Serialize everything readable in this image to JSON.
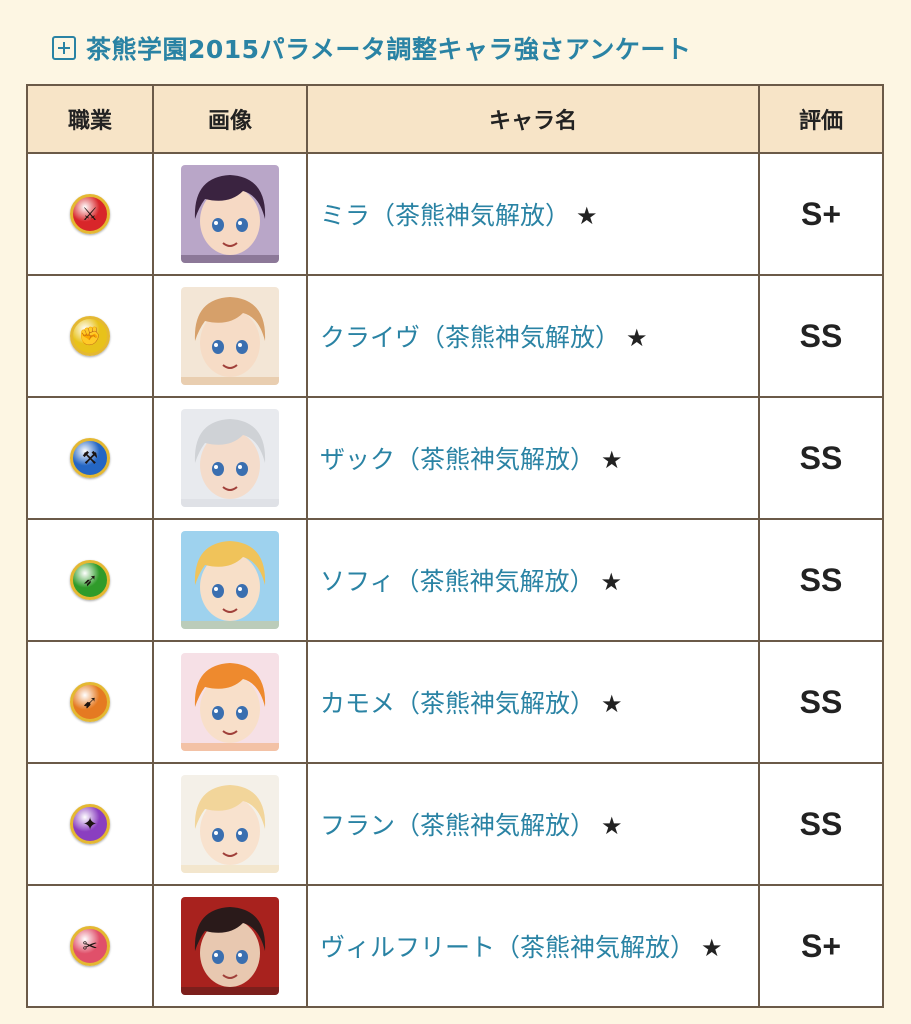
{
  "header": {
    "title": "茶熊学園2015パラメータ調整キャラ強さアンケート"
  },
  "table": {
    "headers": {
      "job": "職業",
      "image": "画像",
      "name": "キャラ名",
      "rating": "評価"
    },
    "rows": [
      {
        "job_icon": "sword-class-icon",
        "job_color": "#d8262a",
        "job_glyph": "⚔",
        "name": "ミラ（茶熊神気解放）",
        "star": "★",
        "rating": "S+",
        "hair": "#3a2340",
        "skin": "#f6d9c4",
        "bg": "#b9a6c8"
      },
      {
        "job_icon": "fist-class-icon",
        "job_color": "#e8c21a",
        "job_glyph": "✊",
        "name": "クライヴ（茶熊神気解放）",
        "star": "★",
        "rating": "SS",
        "hair": "#d6a06a",
        "skin": "#f6dcc6",
        "bg": "#f3e6d6"
      },
      {
        "job_icon": "axe-class-icon",
        "job_color": "#2466c4",
        "job_glyph": "⚒",
        "name": "ザック（茶熊神気解放）",
        "star": "★",
        "rating": "SS",
        "hair": "#cfd2d6",
        "skin": "#f4dccb",
        "bg": "#e8eaee"
      },
      {
        "job_icon": "spear-class-icon",
        "job_color": "#2f9b2a",
        "job_glyph": "➶",
        "name": "ソフィ（茶熊神気解放）",
        "star": "★",
        "rating": "SS",
        "hair": "#f0c35a",
        "skin": "#f7dfc8",
        "bg": "#9ed2ee"
      },
      {
        "job_icon": "bow-class-icon",
        "job_color": "#e57a22",
        "job_glyph": "➹",
        "name": "カモメ（茶熊神気解放）",
        "star": "★",
        "rating": "SS",
        "hair": "#ee8a2e",
        "skin": "#f8dfc9",
        "bg": "#f6e0e6"
      },
      {
        "job_icon": "magic-class-icon",
        "job_color": "#8a3fc0",
        "job_glyph": "✦",
        "name": "フラン（茶熊神気解放）",
        "star": "★",
        "rating": "SS",
        "hair": "#f2d59a",
        "skin": "#f8e2ce",
        "bg": "#f4f0e8"
      },
      {
        "job_icon": "dual-sword-class-icon",
        "job_color": "#e0506a",
        "job_glyph": "✂",
        "name": "ヴィルフリート（茶熊神気解放）",
        "star": "★",
        "rating": "S+",
        "hair": "#2a1a1a",
        "skin": "#e8c8b0",
        "bg": "#a8221e"
      }
    ]
  }
}
